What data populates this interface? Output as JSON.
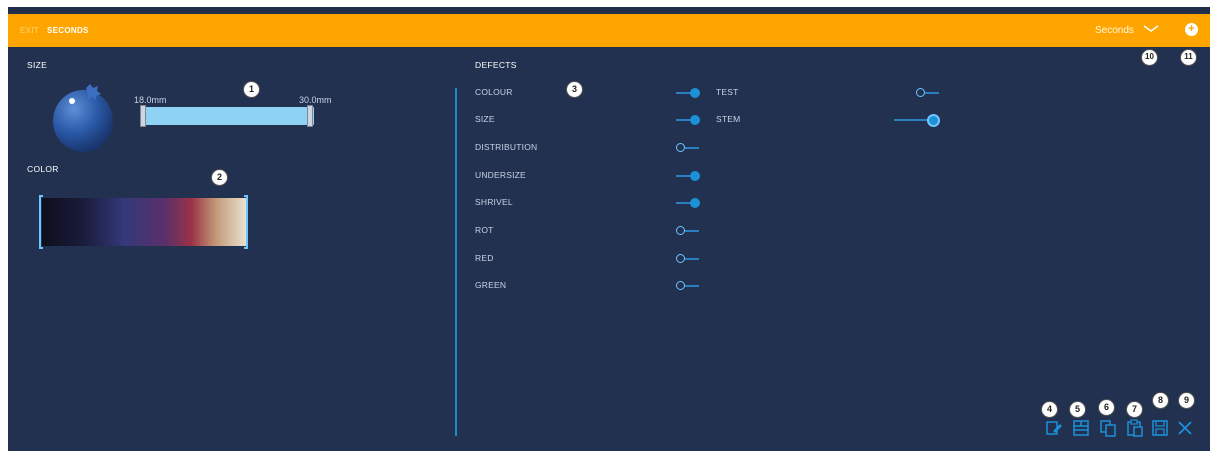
{
  "header": {
    "exit_label": "EXIT",
    "title": "SECONDS",
    "dropdown_value": "Seconds",
    "bar_color": "#ffa500"
  },
  "size": {
    "title": "SIZE",
    "min_label": "18.0mm",
    "max_label": "30.0mm"
  },
  "color": {
    "title": "COLOR"
  },
  "defects": {
    "title": "DEFECTS",
    "left": [
      {
        "label": "COLOUR",
        "on": true
      },
      {
        "label": "SIZE",
        "on": true
      },
      {
        "label": "DISTRIBUTION",
        "on": false
      },
      {
        "label": "UNDERSIZE",
        "on": true
      },
      {
        "label": "SHRIVEL",
        "on": true
      },
      {
        "label": "ROT",
        "on": false
      },
      {
        "label": "RED",
        "on": false
      },
      {
        "label": "GREEN",
        "on": false
      }
    ],
    "right": [
      {
        "label": "TEST",
        "on": false
      },
      {
        "label": "STEM",
        "on": true
      }
    ]
  },
  "callouts": [
    "1",
    "2",
    "3",
    "4",
    "5",
    "6",
    "7",
    "8",
    "9",
    "10",
    "11"
  ],
  "toolbar": {
    "icons": [
      "edit-icon",
      "layout-icon",
      "copy-icon",
      "paste-icon",
      "save-icon",
      "close-icon"
    ]
  },
  "colors": {
    "background": "#21314f",
    "accent": "#1e90d8",
    "range_fill": "#8fd3f4"
  }
}
